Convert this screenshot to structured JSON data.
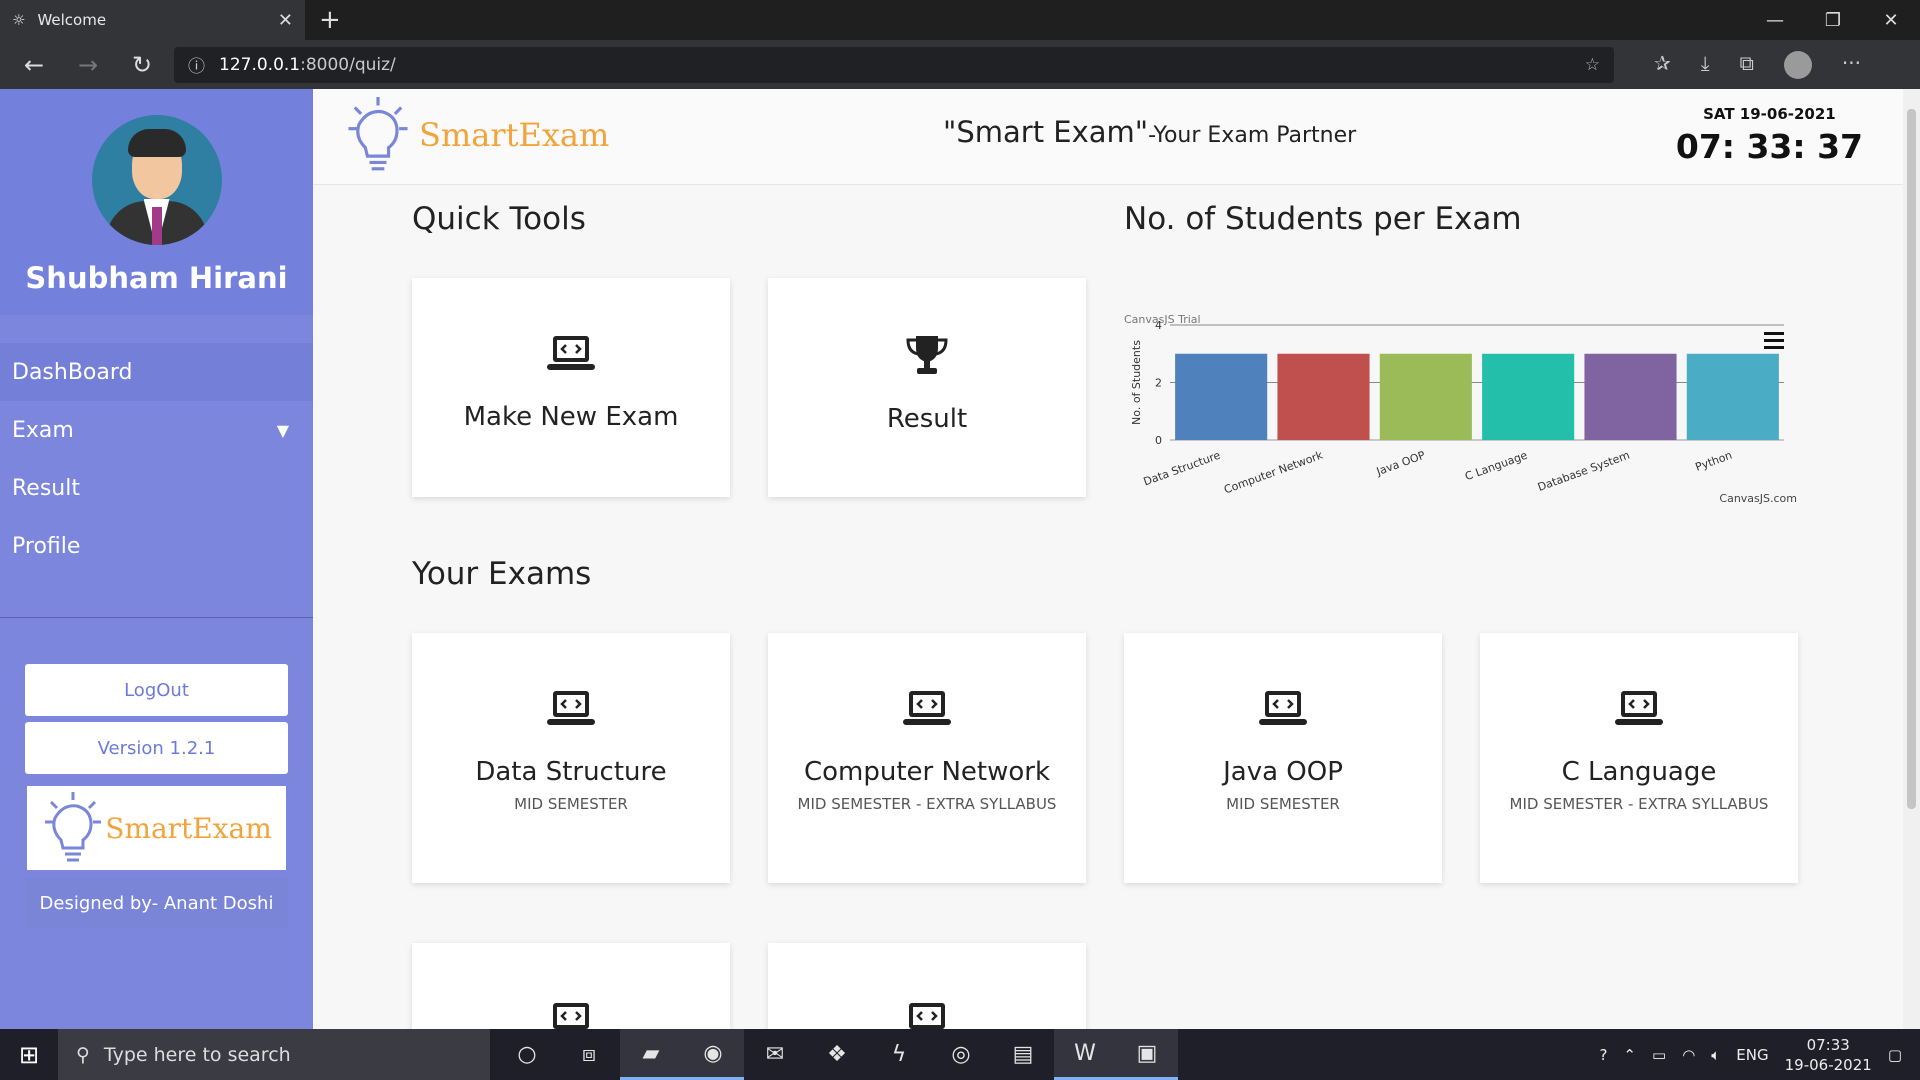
{
  "browser": {
    "tab_title": "Welcome",
    "url_host": "127.0.0.1",
    "url_rest": ":8000/quiz/"
  },
  "sidebar": {
    "username": "Shubham Hirani",
    "menu": [
      "DashBoard",
      "Exam",
      "Result",
      "Profile"
    ],
    "logout_label": "LogOut",
    "version_label": "Version 1.2.1",
    "logo_text": "SmartExam",
    "designed_by": "Designed by- Anant Doshi"
  },
  "header": {
    "brand": "SmartExam",
    "tagline": "\"Smart Exam\"",
    "tagline_sub": "-Your Exam Partner",
    "date": "SAT 19-06-2021",
    "time": "07: 33: 37"
  },
  "quick_tools": {
    "title": "Quick Tools",
    "items": [
      "Make New Exam",
      "Result"
    ]
  },
  "chart_section_title": "No. of Students per Exam",
  "chart_data": {
    "type": "bar",
    "title": "",
    "xlabel": "",
    "ylabel": "No. of Students",
    "ylim": [
      0,
      4
    ],
    "yticks": [
      0,
      2,
      4
    ],
    "categories": [
      "Data Structure",
      "Computer Network",
      "Java OOP",
      "C Language",
      "Database System",
      "Python"
    ],
    "values": [
      3,
      3,
      3,
      3,
      3,
      3
    ],
    "colors": [
      "#4f81bc",
      "#c0504e",
      "#9bbb58",
      "#23bfaa",
      "#8064a1",
      "#4aacc5"
    ],
    "watermark": "CanvasJS Trial",
    "credit": "CanvasJS.com",
    "grid": true
  },
  "exams": {
    "title": "Your Exams",
    "items": [
      {
        "name": "Data Structure",
        "type": "MID SEMESTER"
      },
      {
        "name": "Computer Network",
        "type": "MID SEMESTER - EXTRA SYLLABUS"
      },
      {
        "name": "Java OOP",
        "type": "MID SEMESTER"
      },
      {
        "name": "C Language",
        "type": "MID SEMESTER - EXTRA SYLLABUS"
      }
    ]
  },
  "taskbar": {
    "search_placeholder": "Type here to search",
    "lang": "ENG",
    "time": "07:33",
    "date": "19-06-2021"
  }
}
